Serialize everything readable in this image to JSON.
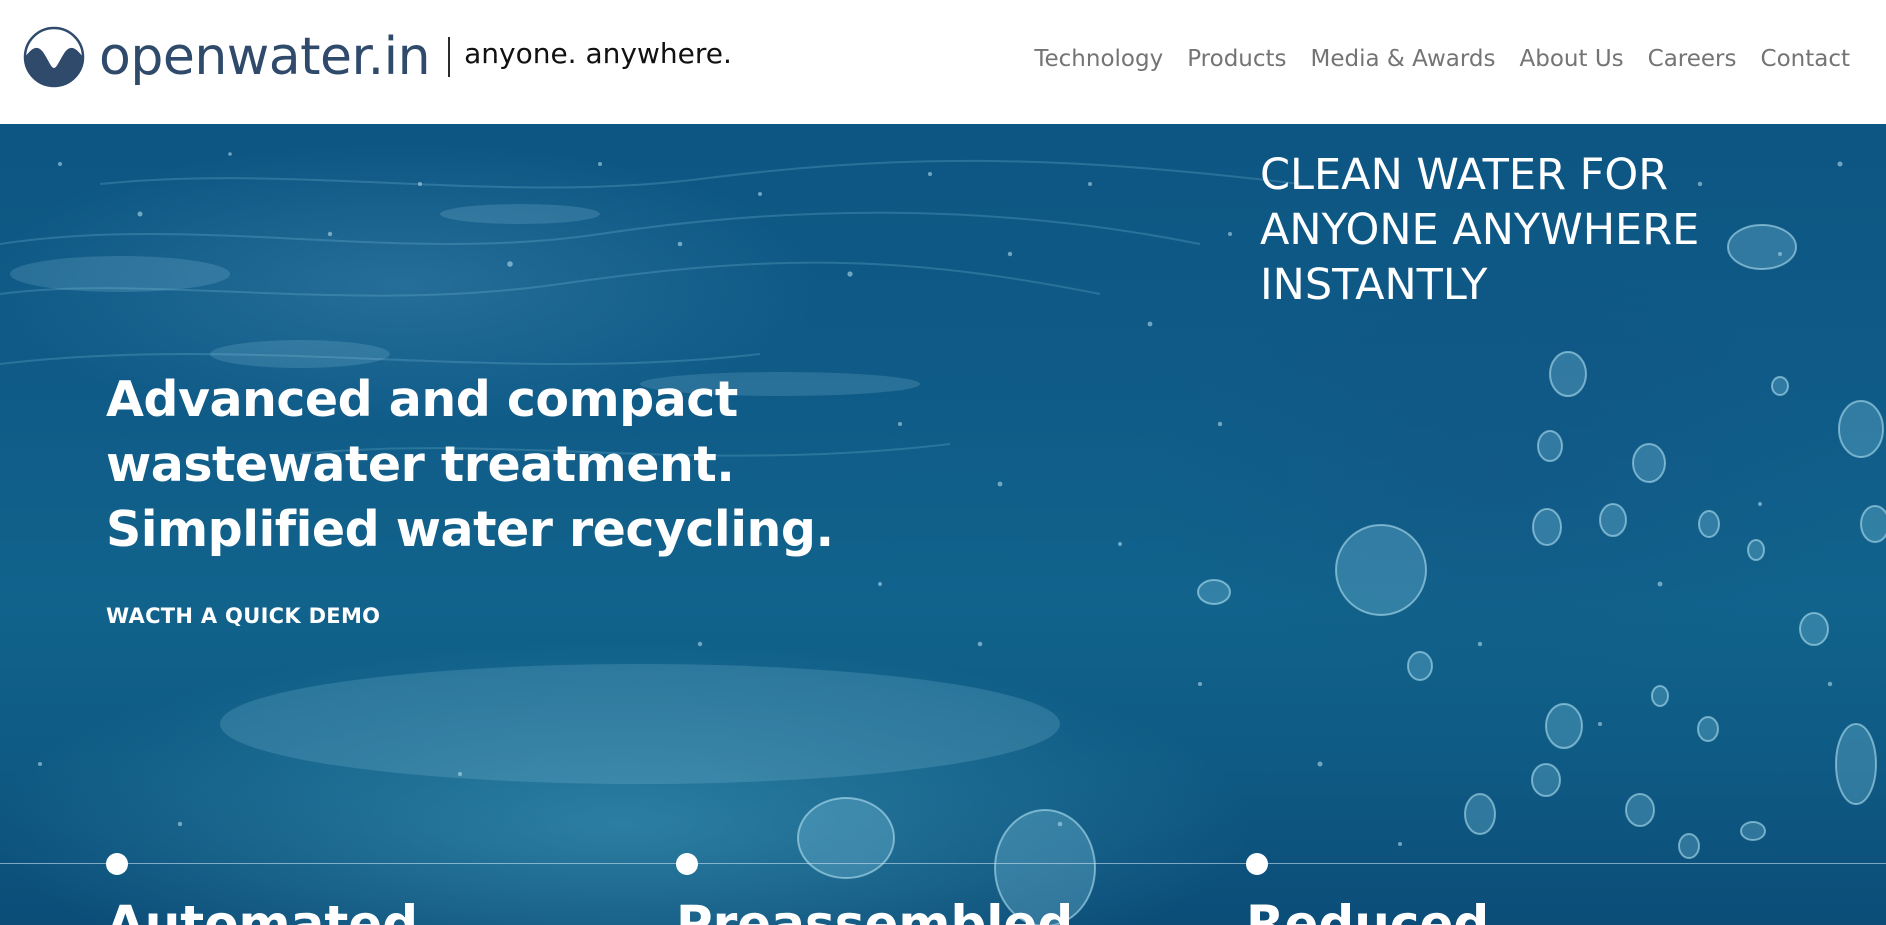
{
  "header": {
    "logo_text": "openwater.in",
    "tagline": "anyone. anywhere.",
    "nav": [
      {
        "label": "Technology"
      },
      {
        "label": "Products"
      },
      {
        "label": "Media & Awards"
      },
      {
        "label": "About Us"
      },
      {
        "label": "Careers"
      },
      {
        "label": "Contact"
      }
    ]
  },
  "hero": {
    "heading_lines": [
      "Advanced and compact",
      "wastewater treatment.",
      "Simplified water recycling."
    ],
    "demo_link": "WACTH A QUICK DEMO",
    "slogan_lines": [
      "CLEAN WATER FOR",
      "ANYONE ANYWHERE",
      "INSTANTLY"
    ],
    "features": [
      {
        "title": "Automated"
      },
      {
        "title": "Preassembled"
      },
      {
        "title": "Reduced"
      }
    ]
  },
  "colors": {
    "brand": "#2f4a6b",
    "nav_text": "#747474",
    "hero_blue": "#0f5a87",
    "hero_text": "#ffffff"
  },
  "icons": {
    "logo": "wave-circle-logo-icon"
  }
}
